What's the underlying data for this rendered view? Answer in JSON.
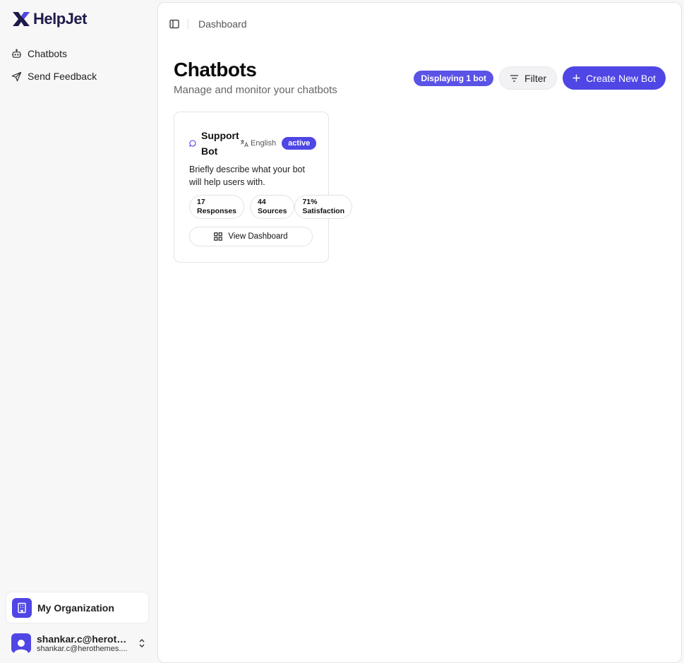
{
  "app": {
    "name": "HelpJet"
  },
  "sidebar": {
    "items": [
      {
        "label": "Chatbots",
        "icon": "bot-icon"
      },
      {
        "label": "Send Feedback",
        "icon": "send-icon"
      }
    ],
    "org": {
      "name": "My Organization",
      "icon": "building-icon"
    },
    "user": {
      "name": "shankar.c@herothe...",
      "email": "shankar.c@herothemes...."
    }
  },
  "header": {
    "breadcrumb": "Dashboard"
  },
  "page": {
    "title": "Chatbots",
    "subtitle": "Manage and monitor your chatbots",
    "count_badge": "Displaying 1 bot",
    "filter_label": "Filter",
    "create_label": "Create New Bot"
  },
  "bots": [
    {
      "name": "Support Bot",
      "language": "English",
      "status": "active",
      "description": "Briefly describe what your bot will help users with.",
      "stats": [
        {
          "value": "17",
          "label": "Responses"
        },
        {
          "value": "44",
          "label": "Sources"
        },
        {
          "value": "71%",
          "label": "Satisfaction"
        }
      ],
      "action_label": "View Dashboard"
    }
  ],
  "colors": {
    "accent": "#4f46e5",
    "badge": "#5b52e6",
    "brand_text": "#1e1b4b"
  }
}
